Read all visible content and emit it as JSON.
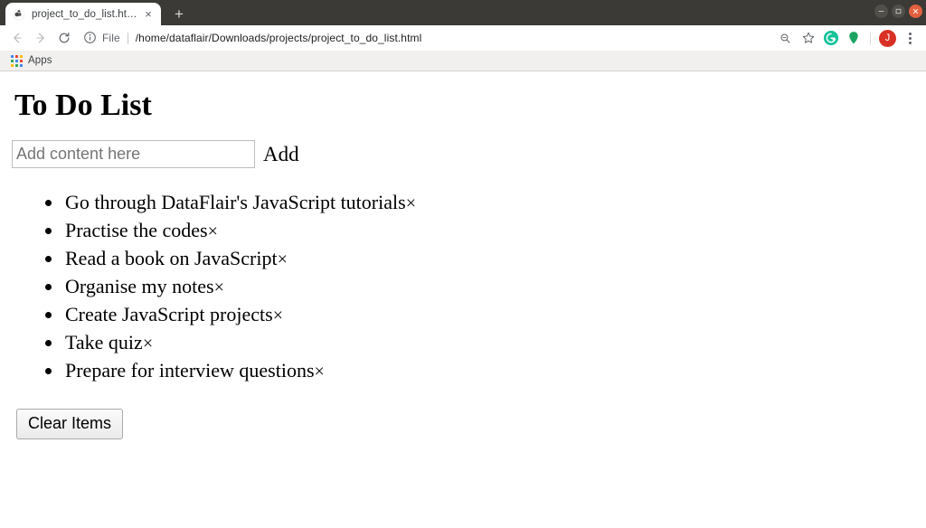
{
  "window": {
    "controls": [
      {
        "name": "minimize",
        "glyph": "–"
      },
      {
        "name": "maximize",
        "glyph": "▢"
      },
      {
        "name": "close",
        "glyph": "×"
      }
    ]
  },
  "browser": {
    "tab": {
      "title": "project_to_do_list.html",
      "favicon": "globe-icon",
      "close_glyph": "×"
    },
    "new_tab_glyph": "+",
    "nav": {
      "back_glyph": "←",
      "forward_glyph": "→",
      "reload_glyph": "↻"
    },
    "omnibox": {
      "security_icon": "info-circle-icon",
      "scheme_label": "File",
      "url": "/home/dataflair/Downloads/projects/project_to_do_list.html"
    },
    "toolbar_icons": [
      {
        "name": "zoom-search-icon",
        "glyph": "⌕"
      },
      {
        "name": "bookmark-star-icon",
        "glyph": "☆"
      },
      {
        "name": "grammarly-extension-icon",
        "letter": "G",
        "color": "#15c39a"
      },
      {
        "name": "location-pin-extension-icon",
        "color": "#1da462"
      }
    ],
    "profile": {
      "initial": "J",
      "color": "#d93025"
    },
    "menu_icon": "three-dot-menu-icon",
    "bookmarks": [
      {
        "name": "apps-shortcut",
        "label": "Apps",
        "icon": "apps-grid-icon"
      }
    ]
  },
  "page": {
    "title": "To Do List",
    "add_form": {
      "input_value": "",
      "input_placeholder": "Add content here",
      "add_label": "Add"
    },
    "todos": [
      {
        "text": "Go through DataFlair's JavaScript tutorials",
        "delete_glyph": "×"
      },
      {
        "text": "Practise the codes",
        "delete_glyph": "×"
      },
      {
        "text": "Read a book on JavaScript",
        "delete_glyph": "×"
      },
      {
        "text": "Organise my notes",
        "delete_glyph": "×"
      },
      {
        "text": "Create JavaScript projects",
        "delete_glyph": "×"
      },
      {
        "text": "Take quiz",
        "delete_glyph": "×"
      },
      {
        "text": "Prepare for interview questions",
        "delete_glyph": "×"
      }
    ],
    "clear_button_label": "Clear Items"
  }
}
